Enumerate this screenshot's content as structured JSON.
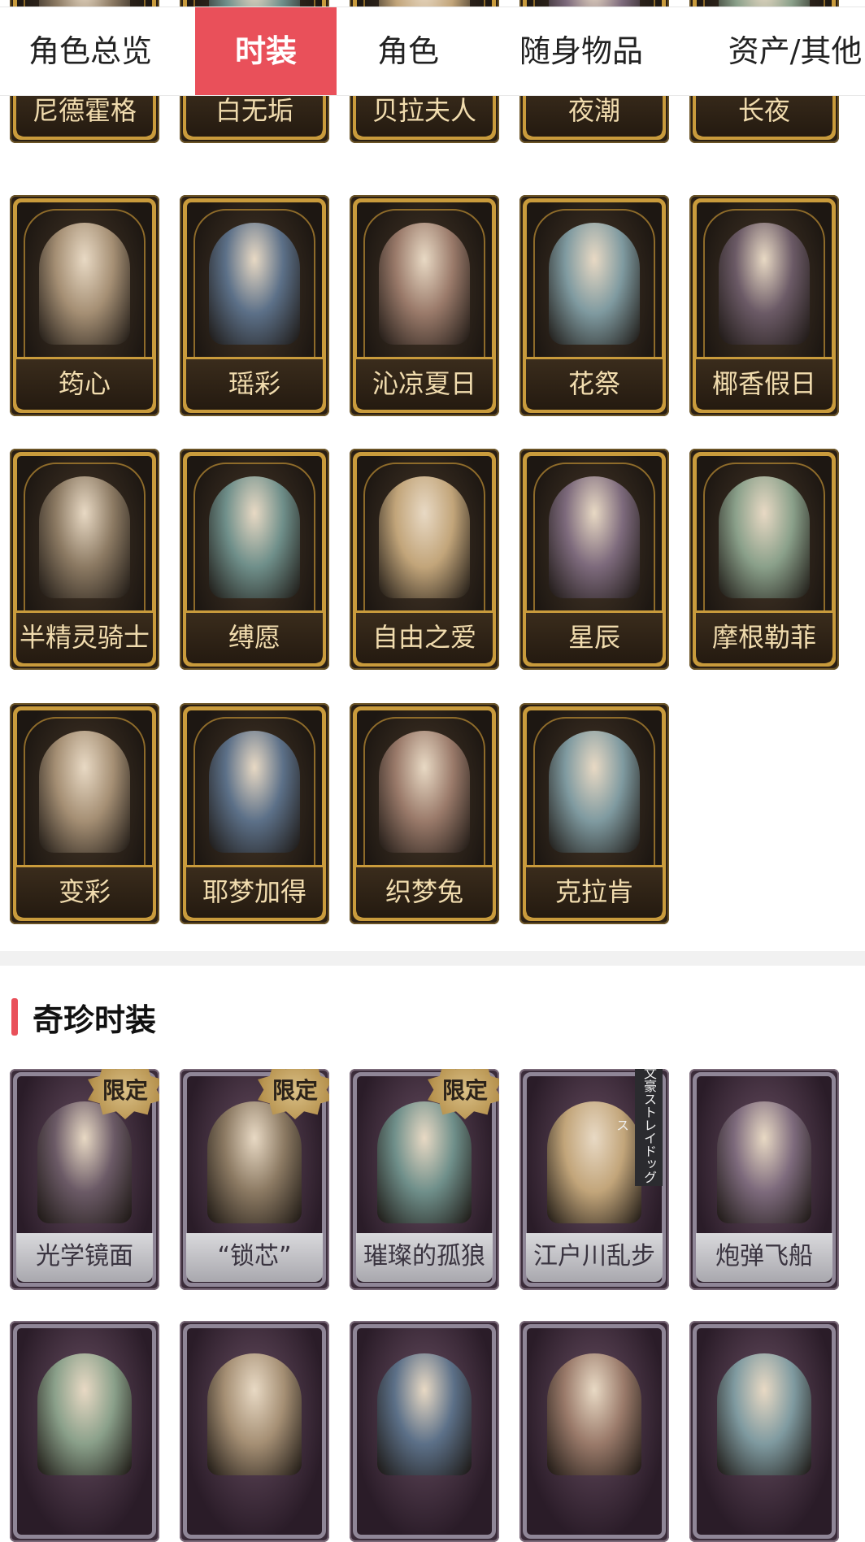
{
  "tabs": [
    {
      "label": "角色总览",
      "active": false
    },
    {
      "label": "时装",
      "active": true
    },
    {
      "label": "角色",
      "active": false
    },
    {
      "label": "随身物品",
      "active": false
    },
    {
      "label": "资产/其他",
      "active": false
    }
  ],
  "costume_rows": [
    [
      "尼德霍格",
      "白无垢",
      "贝拉夫人",
      "夜潮",
      "长夜"
    ],
    [
      "筠心",
      "瑶彩",
      "沁凉夏日",
      "花祭",
      "椰香假日"
    ],
    [
      "半精灵骑士",
      "缚愿",
      "自由之爱",
      "星辰",
      "摩根勒菲"
    ],
    [
      "变彩",
      "耶梦加得",
      "织梦兔",
      "克拉肯"
    ]
  ],
  "rare_section": {
    "title": "奇珍时装",
    "row1": [
      {
        "name": "光学镜面",
        "badge": "限定"
      },
      {
        "name": "“锁芯”",
        "badge": "限定"
      },
      {
        "name": "璀璨的孤狼",
        "badge": "限定"
      },
      {
        "name": "江户川乱步",
        "badge": "文豪ストレイドッグス"
      },
      {
        "name": "炮弹飞船",
        "badge": ""
      }
    ],
    "row2": [
      "",
      "",
      "",
      "",
      ""
    ]
  },
  "colors": {
    "accent": "#e9505a",
    "gold_frame": "#c99b3c",
    "purple_frame": "#8f8697"
  }
}
